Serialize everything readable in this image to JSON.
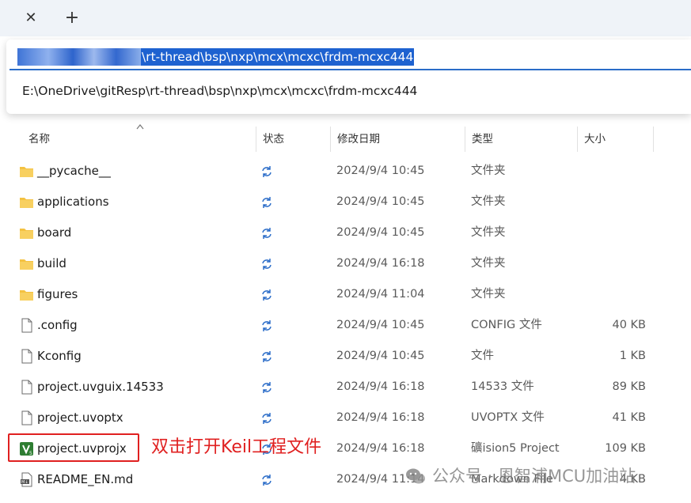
{
  "tabbar": {
    "close_icon": "close-icon",
    "add_icon": "plus-icon",
    "close_glyph": "✕",
    "add_glyph": "+"
  },
  "address": {
    "selected_text": "\\rt-thread\\bsp\\nxp\\mcx\\mcxc\\frdm-mcxc444",
    "suggestion": "E:\\OneDrive\\gitResp\\rt-thread\\bsp\\nxp\\mcx\\mcxc\\frdm-mcxc444"
  },
  "columns": {
    "name": "名称",
    "status": "状态",
    "date": "修改日期",
    "type": "类型",
    "size": "大小"
  },
  "files": [
    {
      "name": "__pycache__",
      "icon": "folder-icon",
      "date": "2024/9/4 10:45",
      "type": "文件夹",
      "size": ""
    },
    {
      "name": "applications",
      "icon": "folder-icon",
      "date": "2024/9/4 10:45",
      "type": "文件夹",
      "size": ""
    },
    {
      "name": "board",
      "icon": "folder-icon",
      "date": "2024/9/4 10:45",
      "type": "文件夹",
      "size": ""
    },
    {
      "name": "build",
      "icon": "folder-icon",
      "date": "2024/9/4 16:18",
      "type": "文件夹",
      "size": ""
    },
    {
      "name": "figures",
      "icon": "folder-icon",
      "date": "2024/9/4 11:04",
      "type": "文件夹",
      "size": ""
    },
    {
      "name": ".config",
      "icon": "file-icon",
      "date": "2024/9/4 10:45",
      "type": "CONFIG 文件",
      "size": "40 KB"
    },
    {
      "name": "Kconfig",
      "icon": "file-icon",
      "date": "2024/9/4 10:45",
      "type": "文件",
      "size": "1 KB"
    },
    {
      "name": "project.uvguix.14533",
      "icon": "file-icon",
      "date": "2024/9/4 16:18",
      "type": "14533 文件",
      "size": "89 KB"
    },
    {
      "name": "project.uvoptx",
      "icon": "file-icon",
      "date": "2024/9/4 16:18",
      "type": "UVOPTX 文件",
      "size": "41 KB"
    },
    {
      "name": "project.uvprojx",
      "icon": "keil-project-icon",
      "date": "2024/9/4 16:18",
      "type": "礦ision5 Project",
      "size": "109 KB"
    },
    {
      "name": "README_EN.md",
      "icon": "markdown-file-icon",
      "date": "2024/9/4 11:14",
      "type": "Markdown File",
      "size": "4 KB"
    }
  ],
  "status_icon": "sync-icon",
  "annotation": {
    "text": "双击打开Keil工程文件",
    "color": "#e02020"
  },
  "watermark": {
    "text": "公众号 · 恩智浦MCU加油站",
    "icon": "wechat-icon"
  },
  "colors": {
    "accent": "#1e62d0",
    "folder": "#f4c242",
    "sync": "#2a6cc8",
    "tabbar": "#eff3f8"
  }
}
